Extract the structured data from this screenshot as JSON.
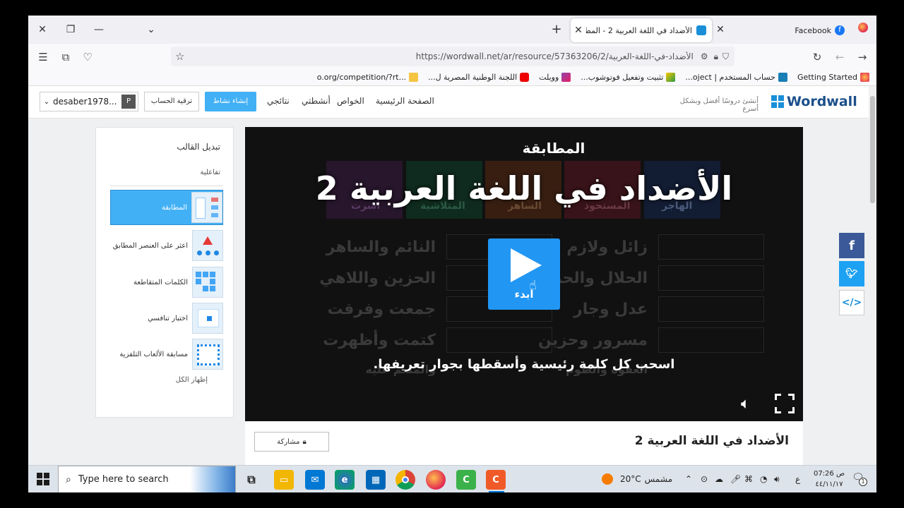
{
  "browser": {
    "tabs": [
      {
        "title": "الأضداد في اللغة العربية 2 - المط",
        "active": true
      },
      {
        "title": "Facebook",
        "active": false
      }
    ],
    "new_tab_label": "+",
    "url": "https://wordwall.net/ar/resource/57363206/2/الأضداد-في-اللغة-العربية",
    "bookmarks": [
      "Getting Started",
      "حساب المستخدم | oject...",
      "تثبيت وتفعيل فوتوشوب...",
      "وويلت",
      "اللجنة الوطنية المصرية ل...",
      "o.org/competition/?rt..."
    ]
  },
  "site": {
    "logo": "Wordwall",
    "tagline": "أنشئ دروسًا أفضل وبشكل أسرع",
    "nav": [
      "الصفحة الرئيسية",
      "الخواص",
      "أنشطتي",
      "نتائجي"
    ],
    "create_button": "إنشاء نشاط",
    "upgrade_button": "ترقية الحساب",
    "account": "desaber1978...",
    "account_initial": "P"
  },
  "sidebar": {
    "title": "تبديل القالب",
    "section": "تفاعلية",
    "items": [
      {
        "label": "المطابقة",
        "active": true
      },
      {
        "label": "اعثر على العنصر المطابق",
        "active": false
      },
      {
        "label": "الكلمات المتقاطعة",
        "active": false
      },
      {
        "label": "اختبار تنافسي",
        "active": false
      },
      {
        "label": "مسابقة الألعاب التلفزية",
        "active": false
      }
    ],
    "show_all": "إظهار الكل"
  },
  "player": {
    "template_name": "المطابقة",
    "activity_title": "الأضداد في اللغة العربية 2",
    "start_label": "ابدء",
    "instruction": "اسحب كل كلمة رئيسية وأسقطها بجوار تعريفها.",
    "bg_left": [
      "النائم والساهر",
      "الحزين واللاهي",
      "جمعت وفرقت",
      "كتمت وأظهرت",
      "والمنعم عليه"
    ],
    "bg_right": [
      "زائل ولازم",
      "الحلال والحرام",
      "عدل وجار",
      "مسرور وحزين",
      "العفوة والطوم"
    ],
    "bg_tiles": [
      "الهاجر",
      "المستحوذ",
      "الساهر",
      "المتلاشية",
      "أسرت"
    ]
  },
  "below": {
    "title": "الأضداد في اللغة العربية 2",
    "share_button": "مشاركة"
  },
  "taskbar": {
    "search_placeholder": "Type here to search",
    "weather_temp": "20°C",
    "weather_desc": "مشمس",
    "lang": "ع",
    "time": "07:26 ص",
    "date": "٤٤/١١/١٧",
    "notif_count": "1"
  },
  "colors": {
    "accent": "#42b0f5",
    "player_bg": "#111111",
    "facebook": "#3b5998",
    "twitter": "#1da1f2",
    "play": "#2196f3"
  }
}
